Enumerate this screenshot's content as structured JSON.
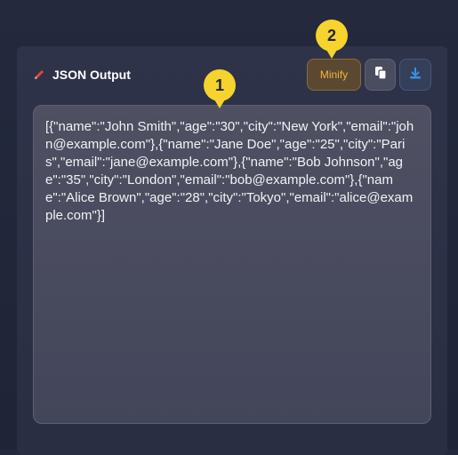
{
  "header": {
    "title": "JSON Output"
  },
  "toolbar": {
    "minify_label": "Minify"
  },
  "output": {
    "text": "[{\"name\":\"John Smith\",\"age\":\"30\",\"city\":\"New York\",\"email\":\"john@example.com\"},{\"name\":\"Jane Doe\",\"age\":\"25\",\"city\":\"Paris\",\"email\":\"jane@example.com\"},{\"name\":\"Bob Johnson\",\"age\":\"35\",\"city\":\"London\",\"email\":\"bob@example.com\"},{\"name\":\"Alice Brown\",\"age\":\"28\",\"city\":\"Tokyo\",\"email\":\"alice@example.com\"}]"
  },
  "markers": {
    "one": "1",
    "two": "2"
  },
  "colors": {
    "accent": "#f1b443",
    "marker": "#f6d32d",
    "download": "#3b8fe0"
  },
  "icons": {
    "title": "pencil-icon",
    "copy": "copy-icon",
    "download": "download-icon"
  }
}
